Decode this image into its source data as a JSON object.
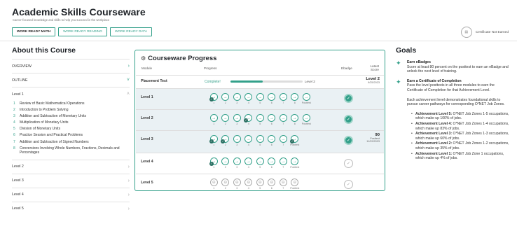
{
  "header": {
    "title": "Academic Skills Courseware",
    "subtitle": "Career-focused knowledge and skills to help you succeed in the workplace",
    "tabs": [
      "WORK READY MATH",
      "WORK READY READING",
      "WORK READY DATA"
    ],
    "certificate_status": "Certificate Not Earned"
  },
  "about": {
    "title": "About this Course",
    "overview": "OVERVIEW",
    "outline": "OUTLINE",
    "level1_label": "Level 1",
    "level1_items": [
      {
        "n": "1",
        "text": "Review of Basic Mathematical Operations"
      },
      {
        "n": "2",
        "text": "Introduction to Problem Solving"
      },
      {
        "n": "3",
        "text": "Addition and Subtraction of Monetary Units"
      },
      {
        "n": "4",
        "text": "Multiplication of Monetary Units"
      },
      {
        "n": "5",
        "text": "Division of Monetary Units"
      },
      {
        "n": "6",
        "text": "Practice Session and Practical Problems"
      },
      {
        "n": "7",
        "text": "Addition and Subtraction of Signed Numbers"
      },
      {
        "n": "8",
        "text": "Conversions Involving Whole Numbers, Fractions, Decimals and Percentages"
      }
    ],
    "other_levels": [
      "Level 2",
      "Level 3",
      "Level 4",
      "Level 5"
    ]
  },
  "progress": {
    "title": "Courseware Progress",
    "col_module": "Module",
    "col_progress": "Progress",
    "col_ebadge": "Ebadge",
    "col_score": "Latest Score",
    "placement": {
      "label": "Placement Test",
      "status": "Complete!",
      "bar_fraction": 0.45,
      "bar_label": "Level 2",
      "score": "Level 2",
      "date": "9/25/2023"
    },
    "levels": [
      {
        "label": "Level 1",
        "ebadge": true,
        "score": "",
        "date": "",
        "steps": [
          "1",
          "2",
          "3",
          "4",
          "5",
          "6",
          "7",
          "8",
          "Posttest"
        ],
        "checked": [
          0
        ],
        "grey": false
      },
      {
        "label": "Level 2",
        "ebadge": true,
        "score": "",
        "date": "",
        "steps": [
          "1",
          "2",
          "3",
          "4",
          "5",
          "6",
          "7",
          "8",
          "Posttest"
        ],
        "checked": [
          3
        ],
        "grey": false
      },
      {
        "label": "Level 3",
        "ebadge": true,
        "score": "90",
        "score_sub": "Posttest",
        "date": "11/29/2023",
        "steps": [
          "1",
          "2",
          "3",
          "4",
          "5",
          "6",
          "7",
          "Posttest"
        ],
        "checked": [
          0,
          1,
          7
        ],
        "grey": false
      },
      {
        "label": "Level 4",
        "ebadge": false,
        "score": "",
        "date": "",
        "steps": [
          "1",
          "2",
          "3",
          "4",
          "5",
          "6",
          "7",
          "Posttest"
        ],
        "checked": [
          0
        ],
        "grey": false
      },
      {
        "label": "Level 5",
        "ebadge": false,
        "score": "",
        "date": "",
        "steps": [
          "1",
          "2",
          "3",
          "4",
          "5",
          "6",
          "7",
          "Posttest"
        ],
        "checked": [],
        "grey": true
      }
    ]
  },
  "goals": {
    "title": "Goals",
    "ebadges_title": "Earn eBadges",
    "ebadges_text": "Score at least 80 percent on the posttest to earn an eBadge and unlock the next level of training.",
    "cert_title": "Earn a Certificate of Completion",
    "cert_text": "Pass the level posttests in all three modules to earn the Certificate of Completion for that Achievement Level.",
    "para": "Each achievement level demonstrates foundational skills to pursue career pathways for corresponding O*NET Job Zones.",
    "achievements": [
      {
        "b": "Achievement Level 5:",
        "t": "O*NET Job Zones 1-5 occupations, which make up 100% of jobs."
      },
      {
        "b": "Achievement Level 4:",
        "t": "O*NET Job Zones 1-4 occupations, which make up 83% of jobs."
      },
      {
        "b": "Achievement Level 3:",
        "t": "O*NET Job Zones 1-3 occupations, which make up 60% of jobs."
      },
      {
        "b": "Achievement Level 2:",
        "t": "O*NET Job Zones 1-2 occupations, which make up 35% of jobs."
      },
      {
        "b": "Achievement Level 1:",
        "t": "O*NET Job Zone 1 occupations, which make up 4% of jobs."
      }
    ]
  }
}
